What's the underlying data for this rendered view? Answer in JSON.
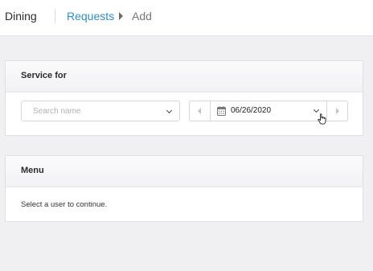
{
  "header": {
    "app_title": "Dining",
    "breadcrumb": {
      "link": "Requests",
      "current": "Add"
    }
  },
  "service_for": {
    "title": "Service for",
    "search": {
      "placeholder": "Search name",
      "value": ""
    },
    "date": {
      "value": "06/26/2020"
    }
  },
  "menu": {
    "title": "Menu",
    "message": "Select a user to continue."
  },
  "colors": {
    "accent": "#2e8fc8",
    "page_bg": "#f0f0f2"
  },
  "icons": [
    "calendar-icon",
    "chevron-down-icon",
    "caret-right-icon",
    "arrow-left-icon",
    "arrow-right-icon",
    "hand-cursor-icon"
  ]
}
